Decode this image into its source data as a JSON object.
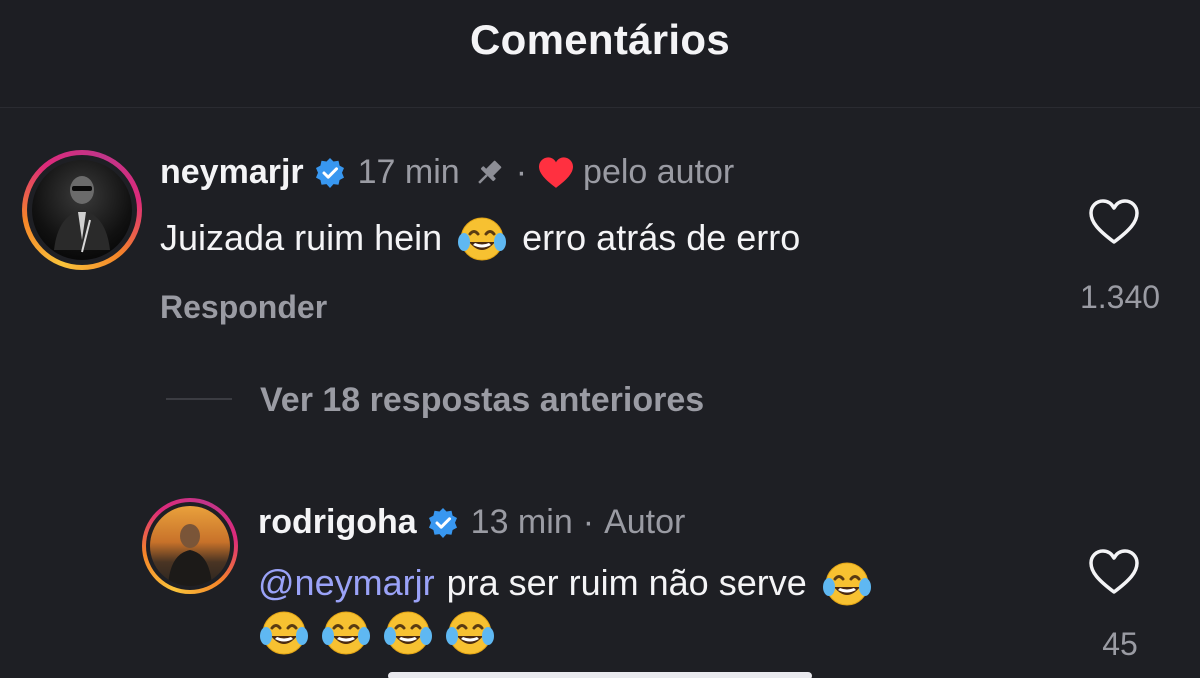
{
  "header": {
    "title": "Comentários"
  },
  "comment": {
    "username": "neymarjr",
    "time": "17 min",
    "separator": "·",
    "liked_by_author": "pelo autor",
    "text_part1": "Juizada ruim hein",
    "text_part2": "erro atrás de erro",
    "reply_label": "Responder",
    "likes": "1.340"
  },
  "view_replies": {
    "label": "Ver 18 respostas anteriores"
  },
  "reply": {
    "username": "rodrigoha",
    "time": "13 min",
    "separator": "·",
    "author_label": "Autor",
    "mention": "@neymarjr",
    "text": "pra ser ruim não serve",
    "likes": "45"
  },
  "colors": {
    "background": "#1e1f24",
    "verified_blue": "#3897f0",
    "heart_red": "#ff3040",
    "mention": "#9aa2f7",
    "muted_text": "#9a9ba3"
  },
  "icons": [
    "verified-badge-icon",
    "pin-icon",
    "red-heart-icon",
    "laughing-emoji-icon",
    "heart-outline-icon"
  ]
}
